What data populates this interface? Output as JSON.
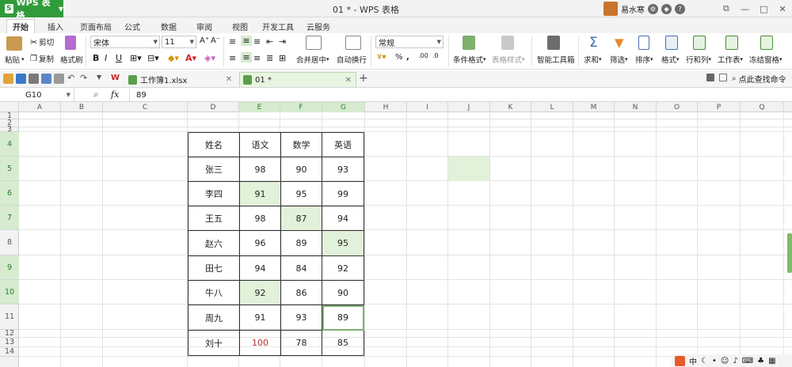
{
  "titlebar": {
    "app_name": "WPS 表格",
    "doc_title": "01 * - WPS 表格",
    "user_name": "易水寒"
  },
  "ribbon_tabs": [
    "开始",
    "插入",
    "页面布局",
    "公式",
    "数据",
    "审阅",
    "视图",
    "开发工具",
    "云服务"
  ],
  "ribbon": {
    "paste": "粘贴",
    "cut": "剪切",
    "copy": "复制",
    "format_painter": "格式刷",
    "font_name": "宋体",
    "font_size": "11",
    "merge_center": "合并居中",
    "wrap_text": "自动换行",
    "number_format": "常规",
    "cond_format": "条件格式",
    "table_style": "表格样式",
    "smart_toolbox": "智能工具箱",
    "sum": "求和",
    "filter": "筛选",
    "sort": "排序",
    "format": "格式",
    "rows_cols": "行和列",
    "worksheet": "工作表",
    "freeze": "冻结窗格"
  },
  "doc_tabs": [
    "工作簿1.xlsx",
    "01 *"
  ],
  "find_command": "点此查找命令",
  "formula_bar": {
    "cell_ref": "G10",
    "fx": "fx",
    "value": "89"
  },
  "columns": [
    "A",
    "B",
    "C",
    "D",
    "E",
    "F",
    "G",
    "H",
    "I",
    "J",
    "K",
    "L",
    "M",
    "N",
    "O",
    "P",
    "Q"
  ],
  "rows": [
    "1",
    "2",
    "3",
    "4",
    "5",
    "6",
    "7",
    "8",
    "9",
    "10",
    "11",
    "12",
    "13",
    "14"
  ],
  "table": {
    "header": [
      "姓名",
      "语文",
      "数学",
      "英语"
    ],
    "rows": [
      [
        "张三",
        "98",
        "90",
        "93"
      ],
      [
        "李四",
        "91",
        "95",
        "99"
      ],
      [
        "王五",
        "98",
        "87",
        "94"
      ],
      [
        "赵六",
        "96",
        "89",
        "95"
      ],
      [
        "田七",
        "94",
        "84",
        "92"
      ],
      [
        "牛八",
        "92",
        "86",
        "90"
      ],
      [
        "周九",
        "91",
        "93",
        "89"
      ],
      [
        "刘十",
        "100",
        "78",
        "85"
      ]
    ]
  },
  "tray": {
    "ime": "中"
  }
}
